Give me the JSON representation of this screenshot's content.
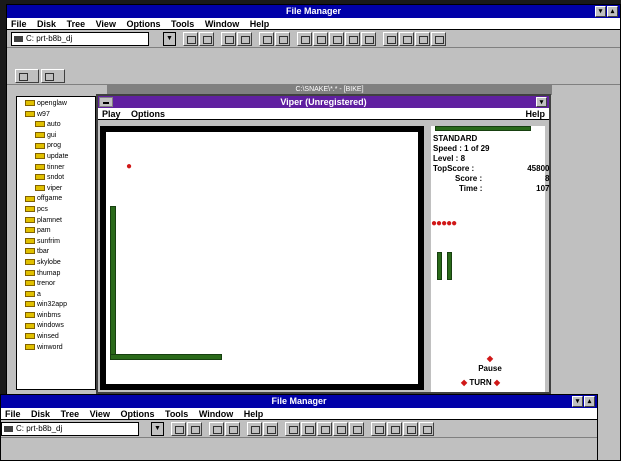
{
  "back_window": {
    "title": "File Manager",
    "menu": [
      "File",
      "Disk",
      "Tree",
      "View",
      "Options",
      "Tools",
      "Window",
      "Help"
    ],
    "drive_selector": "C: prt-b8b_dj",
    "subwindow_title": "C:\\SNAKE\\*.* - [BIKE]"
  },
  "tree": {
    "items": [
      "openglaw",
      "w97",
      "auto",
      "gui",
      "prog",
      "update",
      "tinner",
      "sndot",
      "viper",
      "offgame",
      "pcs",
      "plamnet",
      "pam",
      "sunfrim",
      "tbar",
      "skylobe",
      "thumap",
      "trenor",
      "a",
      "win32app",
      "winbms",
      "windows",
      "winsed",
      "winword"
    ]
  },
  "viper": {
    "title": "Viper (Unregistered)",
    "menu": [
      "Play",
      "Options"
    ],
    "help": "Help",
    "stats": {
      "mode": "STANDARD",
      "speed_label": "Speed :",
      "speed_value": "1 of 29",
      "level_label": "Level :",
      "level_value": "8",
      "topscore_label": "TopScore :",
      "topscore_value": "45800",
      "score_label": "Score :",
      "score_value": "8",
      "time_label": "Time :",
      "time_value": "107"
    },
    "lives_glyphs": "●●●●●",
    "pause": "Pause",
    "turn": "TURN",
    "apple_glyph": "●"
  },
  "front_window": {
    "title": "File Manager",
    "menu": [
      "File",
      "Disk",
      "Tree",
      "View",
      "Options",
      "Tools",
      "Window",
      "Help"
    ],
    "drive_selector": "C: prt-b8b_dj"
  }
}
